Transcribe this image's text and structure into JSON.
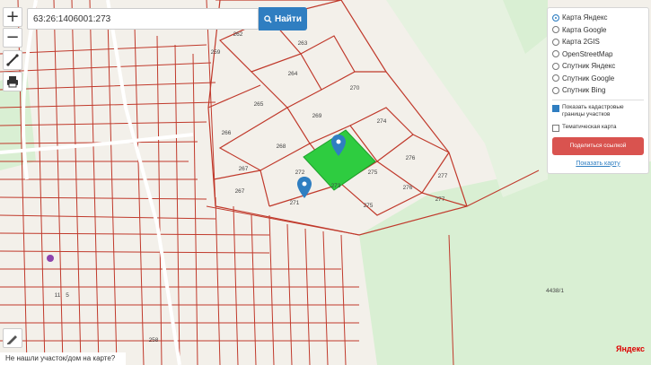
{
  "search": {
    "value": "63:26:1406001:273",
    "button_label": "Найти"
  },
  "controls": {
    "zoom_in": "+",
    "zoom_out": "−"
  },
  "layers": {
    "selected": "Карта Яндекс",
    "options": [
      "Карта Яндекс",
      "Карта Google",
      "Карта 2GIS",
      "OpenStreetMap",
      "Спутник Яндекс",
      "Спутник Google",
      "Спутник Bing"
    ]
  },
  "toggles": {
    "cadastral_label": "Показать кадастровые границы участков",
    "cadastral_checked": true,
    "thematic_label": "Тематическая карта",
    "thematic_checked": false
  },
  "share_button": "Поделиться ссылкой",
  "show_map_link": "Показать карту",
  "bottom_text": "Не нашли участок/дом на карте?",
  "logo": "Яндекс",
  "parcel_labels": {
    "p262": "262",
    "p263": "263",
    "p259": "259",
    "p264": "264",
    "p270": "270",
    "p265": "265",
    "p269": "269",
    "p274": "274",
    "p266": "266",
    "p268": "268",
    "p267": "267",
    "p272": "272",
    "p273": "273",
    "p275a": "275",
    "p276": "276",
    "p277a": "277",
    "p271": "271",
    "p275b": "275",
    "p276b": "276",
    "p277b": "277",
    "p4438": "4438/1",
    "p11": "11",
    "p5": "5",
    "p258": "258"
  },
  "colors": {
    "cadastral_line": "#c0392b",
    "highlight": "#2ecc40",
    "forest": "#d9efd3",
    "accent": "#2f7ec1"
  },
  "icons": {
    "marker": "map-marker-icon",
    "search": "search-icon",
    "ruler": "ruler-icon",
    "print": "printer-icon",
    "pencil": "pencil-icon"
  }
}
